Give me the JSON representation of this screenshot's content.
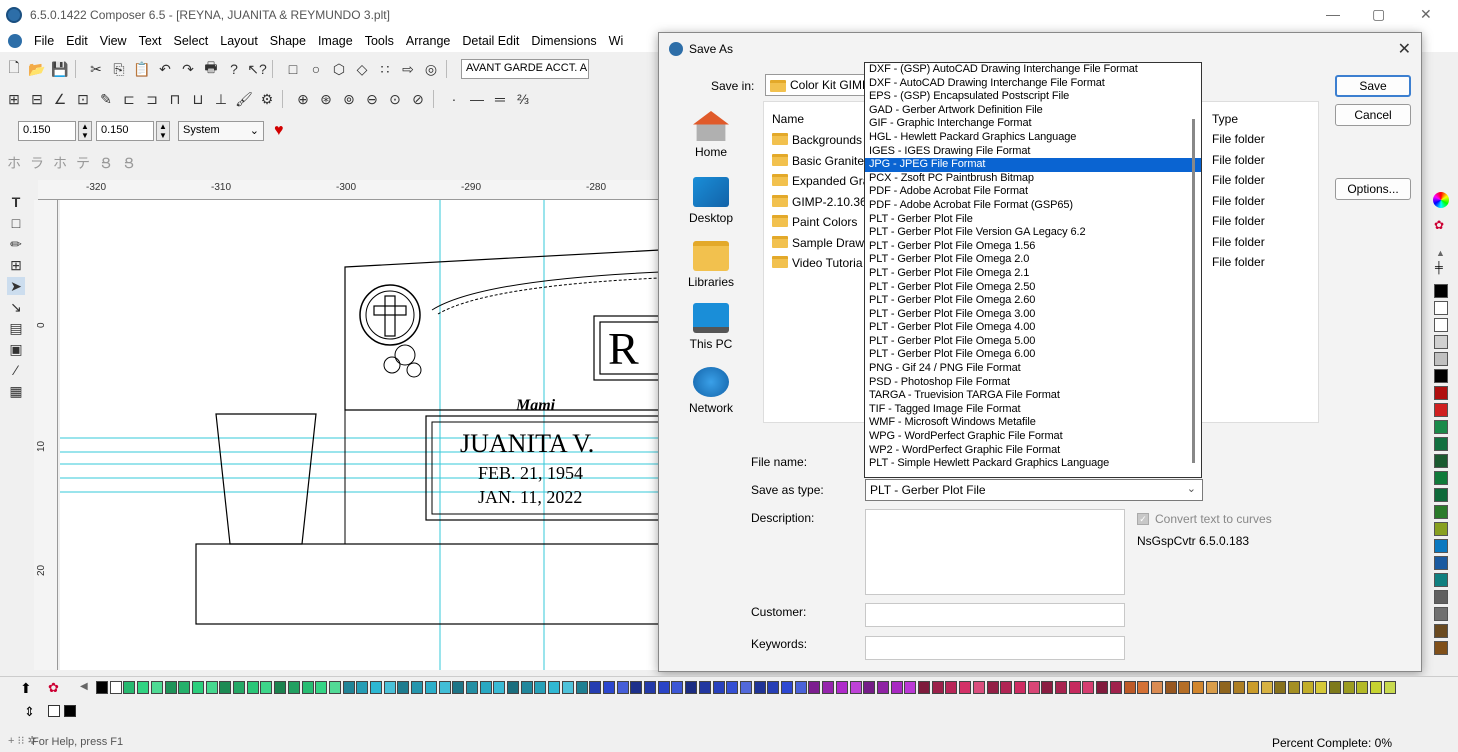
{
  "window": {
    "title": "6.5.0.1422 Composer 6.5 - [REYNA, JUANITA & REYMUNDO 3.plt]"
  },
  "menu": [
    "File",
    "Edit",
    "View",
    "Text",
    "Select",
    "Layout",
    "Shape",
    "Image",
    "Tools",
    "Arrange",
    "Detail Edit",
    "Dimensions",
    "Wi"
  ],
  "toolbar": {
    "font_name": "AVANT GARDE ACCT. A",
    "width_value": "0.150",
    "height_value": "0.150",
    "units": "System"
  },
  "ruler": {
    "top_ticks": [
      "-320",
      "-310",
      "-300",
      "-290",
      "-280"
    ],
    "left_ticks": [
      "0",
      "10",
      "20"
    ]
  },
  "canvas": {
    "monogram": "R",
    "script_name": "Mami",
    "person_name": "JUANITA V.",
    "birth_date": "FEB. 21, 1954",
    "death_date": "JAN. 11, 2022"
  },
  "dialog": {
    "title": "Save As",
    "save_in_label": "Save in:",
    "save_in_value": "Color Kit GIMP",
    "save_button": "Save",
    "cancel_button": "Cancel",
    "options_button": "Options...",
    "places": [
      "Home",
      "Desktop",
      "Libraries",
      "This PC",
      "Network"
    ],
    "columns": {
      "name": "Name",
      "type": "Type"
    },
    "files": [
      {
        "name": "Backgrounds",
        "type": "File folder"
      },
      {
        "name": "Basic Granites",
        "type": "File folder"
      },
      {
        "name": "Expanded Gra",
        "type": "File folder"
      },
      {
        "name": "GIMP-2.10.36",
        "type": "File folder"
      },
      {
        "name": "Paint Colors",
        "type": "File folder"
      },
      {
        "name": "Sample Draw",
        "type": "File folder"
      },
      {
        "name": "Video Tutoria",
        "type": "File folder"
      }
    ],
    "file_name_label": "File name:",
    "save_as_type_label": "Save as type:",
    "save_as_type_value": "PLT - Gerber Plot File",
    "description_label": "Description:",
    "convert_text_label": "Convert text to curves",
    "converter_version": "NsGspCvtr 6.5.0.183",
    "customer_label": "Customer:",
    "keywords_label": "Keywords:"
  },
  "type_dropdown": {
    "selected_index": 7,
    "options": [
      "DXF - (GSP) AutoCAD Drawing Interchange File Format",
      "DXF - AutoCAD Drawing Interchange File Format",
      "EPS - (GSP) Encapsulated Postscript File",
      "GAD - Gerber Artwork Definition File",
      "GIF - Graphic Interchange Format",
      "HGL - Hewlett Packard Graphics Language",
      "IGES - IGES Drawing File Format",
      "JPG - JPEG File Format",
      "PCX - Zsoft PC Paintbrush Bitmap",
      "PDF - Adobe Acrobat File Format",
      "PDF - Adobe Acrobat File Format (GSP65)",
      "PLT - Gerber Plot File",
      "PLT - Gerber Plot File Version GA Legacy 6.2",
      "PLT - Gerber Plot File Omega 1.56",
      "PLT - Gerber Plot File Omega 2.0",
      "PLT - Gerber Plot File Omega 2.1",
      "PLT - Gerber Plot File Omega 2.50",
      "PLT - Gerber Plot File Omega 2.60",
      "PLT - Gerber Plot File Omega 3.00",
      "PLT - Gerber Plot File Omega 4.00",
      "PLT - Gerber Plot File Omega 5.00",
      "PLT - Gerber Plot File Omega 6.00",
      "PNG - Gif 24 / PNG File Format",
      "PSD - Photoshop File Format",
      "TARGA - Truevision TARGA File Format",
      "TIF - Tagged Image File Format",
      "WMF - Microsoft Windows Metafile",
      "WPG - WordPerfect Graphic File Format",
      "WP2 - WordPerfect Graphic File Format",
      "PLT - Simple Hewlett Packard Graphics Language"
    ]
  },
  "status": {
    "help": "For Help, press F1",
    "percent": "Percent Complete: 0%"
  },
  "colors": {
    "selection": "#0a64d2",
    "guide": "#36c8d8",
    "right_palette": [
      "#000000",
      "#ffffff",
      "#ffffff",
      "#d0d0d0",
      "#c0c0c0",
      "#000000",
      "#b01010",
      "#d02020",
      "#1a8a4a",
      "#127040",
      "#1a5a30",
      "#107a3a",
      "#0e6a3a",
      "#2a7a2a",
      "#88a020",
      "#0a78c0",
      "#1a5aa0",
      "#108080",
      "#606060",
      "#707070",
      "#6a4a20",
      "#80501a"
    ]
  }
}
